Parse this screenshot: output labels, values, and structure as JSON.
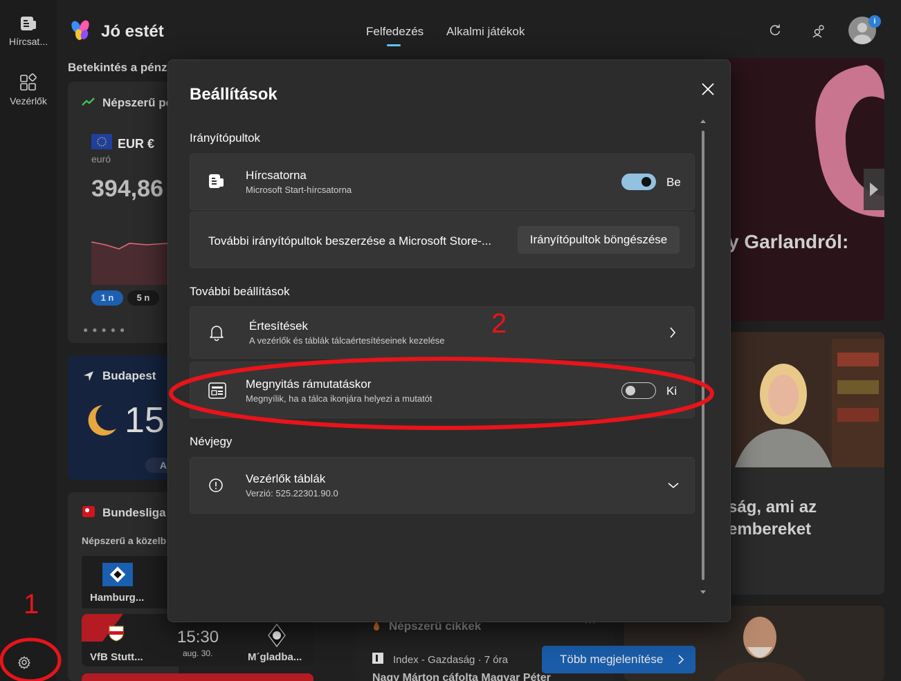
{
  "rail": {
    "items": [
      {
        "label": "Hírcsat...",
        "icon": "news-icon"
      },
      {
        "label": "Vezérlők",
        "icon": "widgets-icon"
      }
    ]
  },
  "header": {
    "greeting": "Jó estét",
    "tabs": [
      {
        "label": "Felfedezés",
        "active": true
      },
      {
        "label": "Alkalmi játékok",
        "active": false
      }
    ],
    "badge": "i"
  },
  "background": {
    "section_title": "Betekintés a pénzü",
    "finance": {
      "title": "Népszerű pé",
      "currency": "EUR €",
      "currency_name": "euró",
      "value": "394,86",
      "pills": [
        "1 n",
        "5 n"
      ]
    },
    "weather": {
      "city": "Budapest",
      "temp": "15",
      "pill": "A t"
    },
    "sports": {
      "title": "Bundesliga",
      "subtitle": "Népszerű a közelb",
      "team1": "Hamburg...",
      "match": {
        "home": "VfB Stutt...",
        "time": "15:30",
        "date": "aug. 30.",
        "away": "M´gladba..."
      }
    },
    "right": {
      "headline1": "y Garlandról:",
      "headline2a": "ság, ami az",
      "headline2b": "embereket"
    },
    "popular": {
      "title": "Népszerű cikkek",
      "source": "Index - Gazdaság · 7 óra",
      "article": "Nagy Márton cáfolta Magyar Péter",
      "more_button": "Több megjelenítése"
    }
  },
  "modal": {
    "title": "Beállítások",
    "section_dashboards": "Irányítópultok",
    "feed": {
      "title": "Hírcsatorna",
      "subtitle": "Microsoft Start-hírcsatorna",
      "state": "Be"
    },
    "store": {
      "text": "További irányítópultok beszerzése a Microsoft Store-...",
      "button": "Irányítópultok böngészése"
    },
    "section_more": "További beállítások",
    "notifications": {
      "title": "Értesítések",
      "subtitle": "A vezérlők és táblák tálcaértesítéseinek kezelése"
    },
    "hover": {
      "title": "Megnyitás rámutatáskor",
      "subtitle": "Megnyílik, ha a tálca ikonjára helyezi a mutatót",
      "state": "Ki"
    },
    "section_about": "Névjegy",
    "about": {
      "title": "Vezérlők táblák",
      "subtitle": "Verzió: 525.22301.90.0"
    }
  },
  "annotations": {
    "label1": "1",
    "label2": "2",
    "color": "#e8141a"
  },
  "colors": {
    "accent": "#60cdff",
    "toggle_on": "#93c2e0",
    "more_button": "#1a5ca8"
  }
}
